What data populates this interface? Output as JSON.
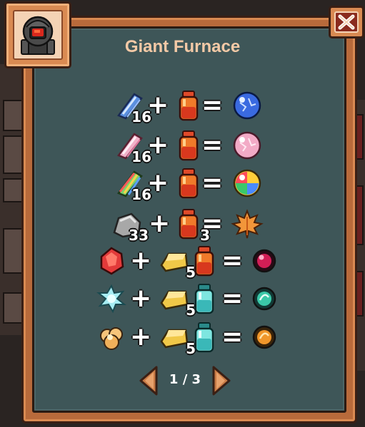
{
  "title": "Giant Furnace",
  "close_icon": "close-x-icon",
  "machine_icon": "furnace-icon",
  "operators": {
    "plus": "+",
    "equals": "="
  },
  "recipes": [
    {
      "inputs": [
        {
          "item": "blue-feather-crystal",
          "qty": "16"
        },
        {
          "item": "red-potion-bottle",
          "qty": ""
        }
      ],
      "output": "blue-orb"
    },
    {
      "inputs": [
        {
          "item": "pink-feather-crystal",
          "qty": "16"
        },
        {
          "item": "red-potion-bottle",
          "qty": ""
        }
      ],
      "output": "pink-orb"
    },
    {
      "inputs": [
        {
          "item": "rainbow-feather-crystal",
          "qty": "16"
        },
        {
          "item": "red-potion-bottle",
          "qty": ""
        }
      ],
      "output": "rainbow-orb"
    },
    {
      "inputs": [
        {
          "item": "grey-rock",
          "qty": "33"
        },
        {
          "item": "red-potion-bottle",
          "qty": "3"
        }
      ],
      "output": "orange-maple-leaf"
    },
    {
      "inputs": [
        {
          "item": "red-gem",
          "qty": ""
        },
        {
          "item": "gold-bar",
          "qty": "5"
        },
        {
          "item": "red-potion-bottle",
          "qty": ""
        }
      ],
      "output": "crimson-orb"
    },
    {
      "inputs": [
        {
          "item": "cyan-crystal-cluster",
          "qty": ""
        },
        {
          "item": "gold-bar",
          "qty": "5"
        },
        {
          "item": "cyan-potion-bottle",
          "qty": ""
        }
      ],
      "output": "teal-orb"
    },
    {
      "inputs": [
        {
          "item": "orange-popcorn-nugget",
          "qty": ""
        },
        {
          "item": "gold-bar",
          "qty": "5"
        },
        {
          "item": "cyan-potion-bottle",
          "qty": ""
        }
      ],
      "output": "amber-orb"
    }
  ],
  "pagination": {
    "text": "1 / 3",
    "prev_icon": "arrow-left-icon",
    "next_icon": "arrow-right-icon"
  },
  "colors": {
    "panel_frame": "#b86a3b",
    "panel_inner": "#3e5658",
    "title": "#f3c9a6",
    "close_bg": "#8a2b1e"
  }
}
